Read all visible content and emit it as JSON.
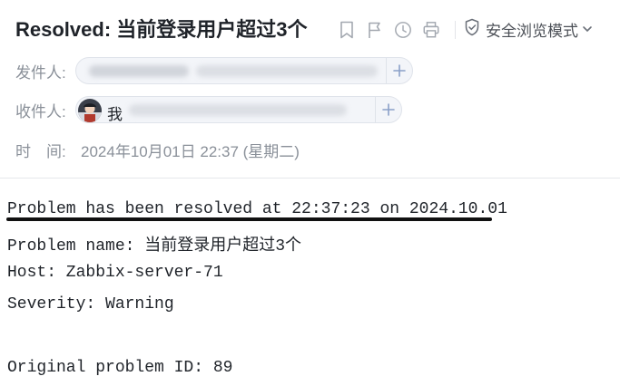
{
  "email": {
    "subject": "Resolved: 当前登录用户超过3个",
    "toolbar": {
      "icons": [
        "bookmark-icon",
        "flag-icon",
        "clock-icon",
        "print-icon"
      ],
      "safe_mode_label": "安全浏览模式",
      "safe_mode_icon": "shield-icon"
    },
    "from": {
      "label": "发件人:"
    },
    "to": {
      "label": "收件人:",
      "recipient_name": "我"
    },
    "time": {
      "label": "时　间:",
      "value": "2024年10月01日 22:37 (星期二)"
    },
    "body": [
      "Problem has been resolved at 22:37:23 on 2024.10.01",
      "Problem name: 当前登录用户超过3个",
      "Host: Zabbix-server-71",
      "Severity: Warning",
      "",
      "Original problem ID: 89"
    ]
  },
  "colors": {
    "text": "#1f2329",
    "muted": "#8a9099",
    "pill_bg": "#f3f5f9",
    "pill_border": "#dfe3ea",
    "add_icon": "#8aa0c8",
    "underline": "#111111"
  }
}
